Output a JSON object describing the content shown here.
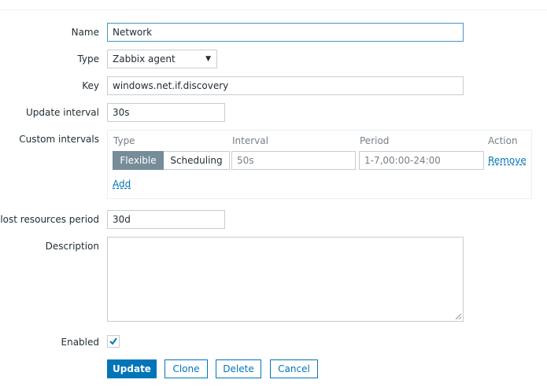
{
  "form": {
    "name": {
      "label": "Name",
      "value": "Network"
    },
    "type": {
      "label": "Type",
      "value": "Zabbix agent"
    },
    "key": {
      "label": "Key",
      "value": "windows.net.if.discovery"
    },
    "update_interval": {
      "label": "Update interval",
      "value": "30s"
    },
    "custom_intervals": {
      "label": "Custom intervals",
      "headers": {
        "type": "Type",
        "interval": "Interval",
        "period": "Period",
        "action": "Action"
      },
      "rows": [
        {
          "type_options": [
            "Flexible",
            "Scheduling"
          ],
          "selected": "Flexible",
          "interval": "50s",
          "period": "1-7,00:00-24:00",
          "action": "Remove"
        }
      ],
      "add_label": "Add"
    },
    "lost_resources": {
      "label": "ep lost resources period",
      "value": "30d"
    },
    "description": {
      "label": "Description",
      "value": ""
    },
    "enabled": {
      "label": "Enabled",
      "checked": true
    }
  },
  "buttons": {
    "update": "Update",
    "clone": "Clone",
    "delete": "Delete",
    "cancel": "Cancel"
  },
  "icons": {
    "select_arrow": "dropdown-arrow-icon",
    "checkmark": "checkmark-icon",
    "resize": "resize-grip-icon"
  },
  "colors": {
    "accent": "#0275b8",
    "segment_active": "#768d99",
    "focus_border": "#4796c4"
  }
}
